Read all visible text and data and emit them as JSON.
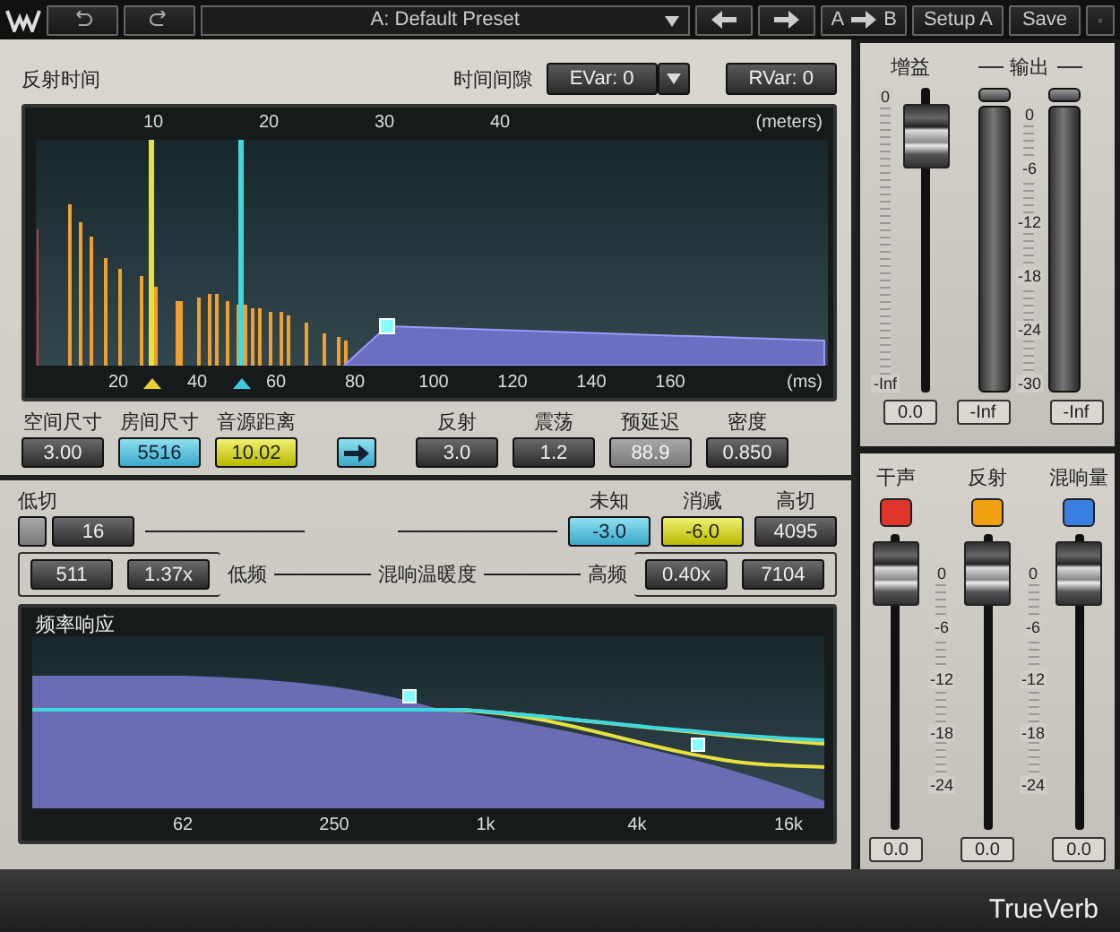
{
  "toolbar": {
    "preset": "A: Default Preset",
    "compare_from": "A",
    "compare_to": "B",
    "setup": "Setup A",
    "save": "Save"
  },
  "reflections": {
    "title": "反射时间",
    "gap_label": "时间间隙",
    "evar": "EVar: 0",
    "rvar": "RVar: 0",
    "meter_ticks": [
      "10",
      "20",
      "30",
      "40"
    ],
    "meter_unit": "(meters)",
    "ms_ticks": [
      "20",
      "40",
      "60",
      "80",
      "100",
      "120",
      "140",
      "160"
    ],
    "ms_unit": "(ms)",
    "params_left": [
      {
        "label": "空间尺寸",
        "value": "3.00",
        "kind": "plain"
      },
      {
        "label": "房间尺寸",
        "value": "5516",
        "kind": "cyan"
      },
      {
        "label": "音源距离",
        "value": "10.02",
        "kind": "yellow"
      }
    ],
    "params_right": [
      {
        "label": "反射",
        "value": "3.0",
        "kind": "plain"
      },
      {
        "label": "震荡",
        "value": "1.2",
        "kind": "plain"
      },
      {
        "label": "预延迟",
        "value": "88.9",
        "kind": "dim"
      },
      {
        "label": "密度",
        "value": "0.850",
        "kind": "plain"
      }
    ]
  },
  "filters": {
    "lowcut_label": "低切",
    "lowcut_value": "16",
    "right": [
      {
        "label": "未知",
        "value": "-3.0",
        "kind": "cyan"
      },
      {
        "label": "消减",
        "value": "-6.0",
        "kind": "yellow"
      },
      {
        "label": "高切",
        "value": "4095",
        "kind": "plain"
      }
    ],
    "low_freq": "511",
    "low_ratio": "1.37x",
    "low_label": "低频",
    "warmth_label": "混响温暖度",
    "high_label": "高频",
    "high_ratio": "0.40x",
    "high_freq": "7104"
  },
  "response": {
    "title": "频率响应",
    "freq_ticks": [
      "62",
      "250",
      "1k",
      "4k",
      "16k"
    ]
  },
  "gain": {
    "label": "增益",
    "level": 0.93,
    "scale": [
      "0",
      "-Inf"
    ],
    "value": "0.0"
  },
  "output": {
    "label": "输出",
    "scale": [
      "0",
      "-6",
      "-12",
      "-18",
      "-24",
      "-30"
    ],
    "meters": [
      {
        "level": 0,
        "value": "-Inf"
      },
      {
        "level": 0,
        "value": "-Inf"
      }
    ]
  },
  "mix": {
    "channels": [
      {
        "label": "干声",
        "color": "#e0352a",
        "level": 0.97,
        "value": "0.0"
      },
      {
        "label": "反射",
        "color": "#f0a010",
        "level": 0.97,
        "value": "0.0"
      },
      {
        "label": "混响量",
        "color": "#3a7ee0",
        "level": 0.97,
        "value": "0.0"
      }
    ],
    "scales": [
      [
        "0",
        "-6",
        "-12",
        "-18",
        "-24"
      ],
      [
        "0",
        "-6",
        "-12",
        "-18",
        "-24"
      ]
    ]
  },
  "product": "TrueVerb"
}
